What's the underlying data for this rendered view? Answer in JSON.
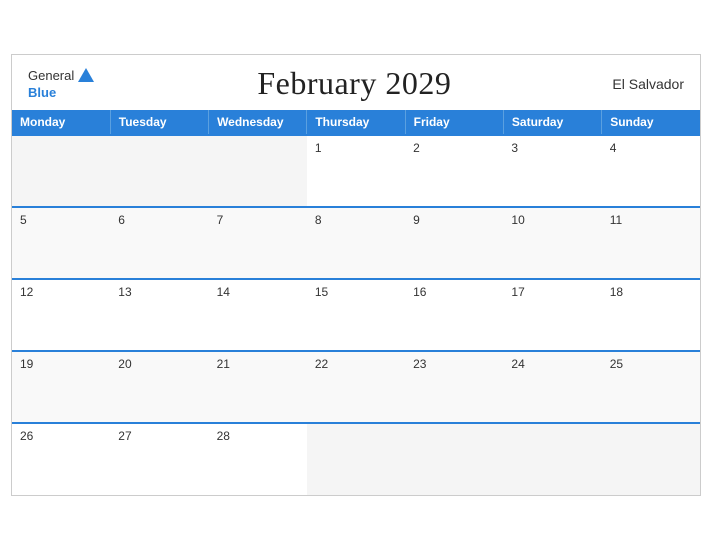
{
  "header": {
    "logo_general": "General",
    "logo_blue": "Blue",
    "title": "February 2029",
    "country": "El Salvador"
  },
  "days_of_week": [
    "Monday",
    "Tuesday",
    "Wednesday",
    "Thursday",
    "Friday",
    "Saturday",
    "Sunday"
  ],
  "weeks": [
    [
      null,
      null,
      null,
      1,
      2,
      3,
      4
    ],
    [
      5,
      6,
      7,
      8,
      9,
      10,
      11
    ],
    [
      12,
      13,
      14,
      15,
      16,
      17,
      18
    ],
    [
      19,
      20,
      21,
      22,
      23,
      24,
      25
    ],
    [
      26,
      27,
      28,
      null,
      null,
      null,
      null
    ]
  ]
}
